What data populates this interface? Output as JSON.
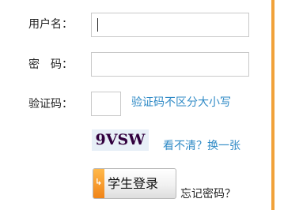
{
  "form": {
    "username": {
      "label": "用户名：",
      "value": ""
    },
    "password": {
      "label": "密　码：",
      "value": ""
    },
    "captcha": {
      "label": "验证码：",
      "value": "",
      "hint": "验证码不区分大小写",
      "image_text": "9VSW",
      "refresh_label": "看不清？换一张"
    },
    "login_button": {
      "label": "学生登录",
      "accent_icon": "arrow-icon"
    },
    "forgot_password_label": "忘记密码？"
  },
  "colors": {
    "accent": "#f1a23a",
    "link": "#2f8ac6",
    "captcha_bg": "#e7eff7"
  }
}
